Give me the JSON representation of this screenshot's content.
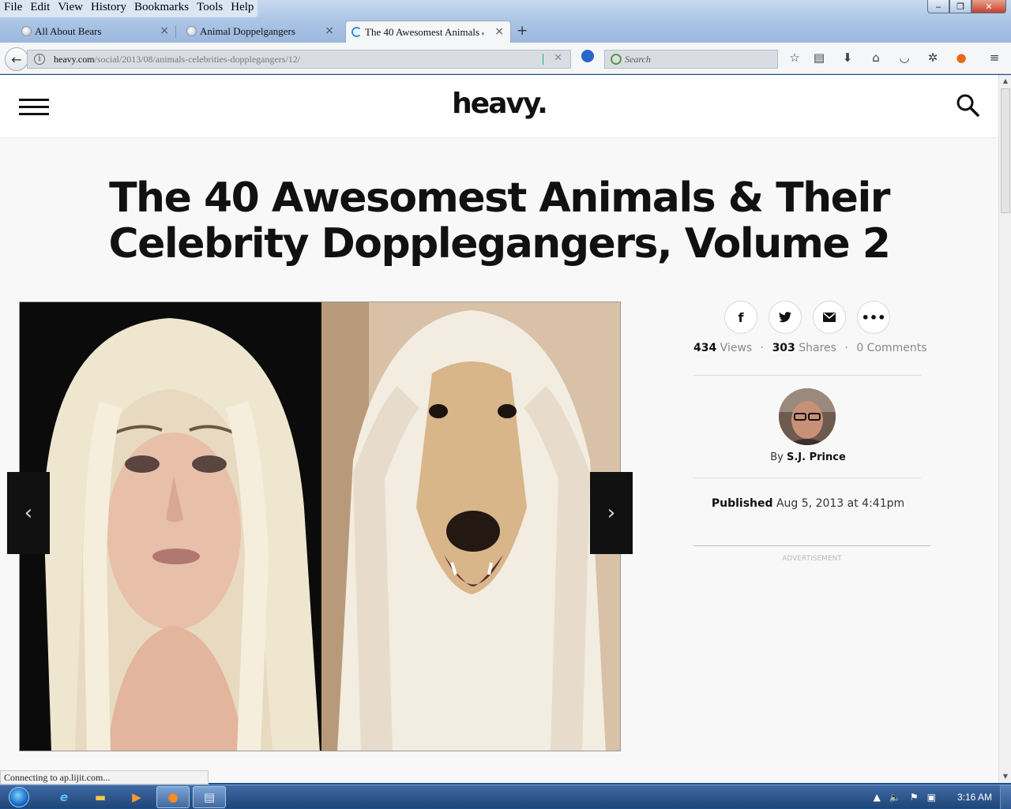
{
  "menubar": [
    "File",
    "Edit",
    "View",
    "History",
    "Bookmarks",
    "Tools",
    "Help"
  ],
  "window_controls": {
    "minimize_icon": "minimize-icon",
    "maximize_icon": "maximize-icon",
    "close_icon": "close-icon"
  },
  "tabs": [
    {
      "title": "All About Bears",
      "active": false
    },
    {
      "title": "Animal Doppelgangers",
      "active": false
    },
    {
      "title": "The 40 Awesomest Animals & T",
      "active": true
    }
  ],
  "navbar": {
    "url_domain": "heavy.com",
    "url_path": "/social/2013/08/animals-celebrities-dopplegangers/12/",
    "search_placeholder": "Search"
  },
  "site": {
    "logo": "heavy."
  },
  "article": {
    "title": "The 40 Awesomest Animals & Their Celebrity Dopplegangers, Volume 2",
    "views_count": "434",
    "views_label": " Views",
    "shares_count": "303",
    "shares_label": " Shares",
    "comments": "0 Comments",
    "dot": "·",
    "by_label": "By ",
    "author": "S.J. Prince",
    "published_label": "Published",
    "published_date": " Aug 5, 2013 at 4:41pm",
    "advertisement": "ADVERTISEMENT"
  },
  "share_buttons": [
    "facebook-icon",
    "twitter-icon",
    "email-icon",
    "more-icon"
  ],
  "statusbar": "Connecting to ap.lijit.com...",
  "taskbar": {
    "clock": "3:16 AM"
  },
  "colors": {
    "page_bg": "#f8f8f8",
    "title": "#111111",
    "taskbar": "#2a5288"
  }
}
